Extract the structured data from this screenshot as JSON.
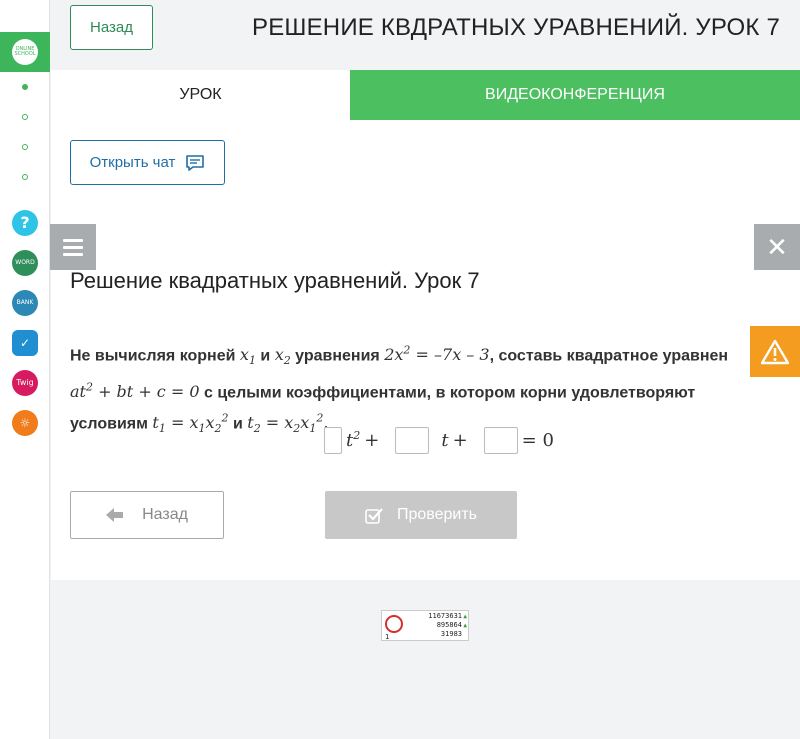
{
  "sidebar": {
    "logo": {
      "text": "ONLINE SCHOOL",
      "color": "#3db55a"
    },
    "apps": [
      {
        "name": "help",
        "label": "?",
        "color": "#2ec4e6"
      },
      {
        "name": "word",
        "label": "WORD",
        "color": "#2f8f5a"
      },
      {
        "name": "bank",
        "label": "BANK",
        "color": "#2c89b5"
      },
      {
        "name": "tasks",
        "label": "✓",
        "color": "#1f8fd1"
      },
      {
        "name": "twig",
        "label": "Twig",
        "color": "#d81b60"
      },
      {
        "name": "rating",
        "label": "☼",
        "color": "#f07c1b"
      }
    ]
  },
  "header": {
    "back_label": "Назад",
    "title": "РЕШЕНИЕ КВДРАТНЫХ УРАВНЕНИЙ. УРОК 7"
  },
  "tabs": [
    {
      "label": "УРОК",
      "active": true
    },
    {
      "label": "ВИДЕОКОНФЕРЕНЦИЯ",
      "active": false
    }
  ],
  "main": {
    "chat_button": "Открыть чат",
    "lesson_title": "Решение квадратных уравнений. Урок 7",
    "task": {
      "p1": "Не вычисляя корней",
      "and1": "и",
      "p2": "уравнения",
      "p3": ", составь квадратное уравнен",
      "p4": "с целыми коэффициентами, в котором корни удовлетворяют",
      "p5": "условиям",
      "and2": "и"
    },
    "answer_row": {
      "box1": "",
      "box2": "",
      "box3": "",
      "tail": "= 0"
    },
    "back_button": "Назад",
    "check_button": "Проверить"
  },
  "counter": {
    "line1": "11673631",
    "line2": "895864",
    "line3": "31983",
    "corner": "1"
  },
  "colors": {
    "accent_green": "#4cbf60",
    "outline_green": "#2e8b57",
    "chat_blue": "#1f6ea8",
    "warning": "#f39c1f",
    "disabled": "#c8c8c8"
  }
}
